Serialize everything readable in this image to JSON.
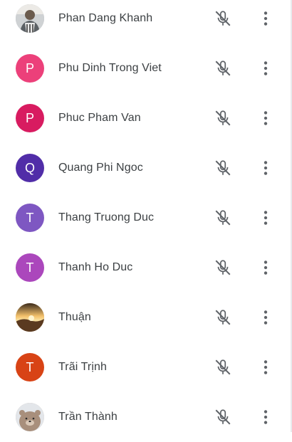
{
  "participants": [
    {
      "name": "Phan Dang Khanh",
      "initial": "",
      "avatar_color": "#9aa0a6",
      "avatar_type": "photo-person",
      "mic_icon": "mic-off-icon",
      "menu_icon": "more-vert-icon"
    },
    {
      "name": "Phu Dinh Trong Viet",
      "initial": "P",
      "avatar_color": "#ec407a",
      "avatar_type": "letter",
      "mic_icon": "mic-off-icon",
      "menu_icon": "more-vert-icon"
    },
    {
      "name": "Phuc Pham Van",
      "initial": "P",
      "avatar_color": "#d81b60",
      "avatar_type": "letter",
      "mic_icon": "mic-off-icon",
      "menu_icon": "more-vert-icon"
    },
    {
      "name": "Quang Phi Ngoc",
      "initial": "Q",
      "avatar_color": "#512da8",
      "avatar_type": "letter",
      "mic_icon": "mic-off-icon",
      "menu_icon": "more-vert-icon"
    },
    {
      "name": "Thang Truong Duc",
      "initial": "T",
      "avatar_color": "#7e57c2",
      "avatar_type": "letter",
      "mic_icon": "mic-off-icon",
      "menu_icon": "more-vert-icon"
    },
    {
      "name": "Thanh Ho Duc",
      "initial": "T",
      "avatar_color": "#ab47bc",
      "avatar_type": "letter",
      "mic_icon": "mic-off-icon",
      "menu_icon": "more-vert-icon"
    },
    {
      "name": "Thuận",
      "initial": "",
      "avatar_color": "#c98a3a",
      "avatar_type": "photo-sunset",
      "mic_icon": "mic-off-icon",
      "menu_icon": "more-vert-icon"
    },
    {
      "name": "Trãi Trịnh",
      "initial": "T",
      "avatar_color": "#d84315",
      "avatar_type": "letter",
      "mic_icon": "mic-off-icon",
      "menu_icon": "more-vert-icon"
    },
    {
      "name": "Trần Thành",
      "initial": "",
      "avatar_color": "#b9a89a",
      "avatar_type": "photo-bear",
      "mic_icon": "mic-off-icon",
      "menu_icon": "more-vert-icon"
    }
  ],
  "colors": {
    "text": "#3c4043",
    "icon": "#5f6368"
  }
}
